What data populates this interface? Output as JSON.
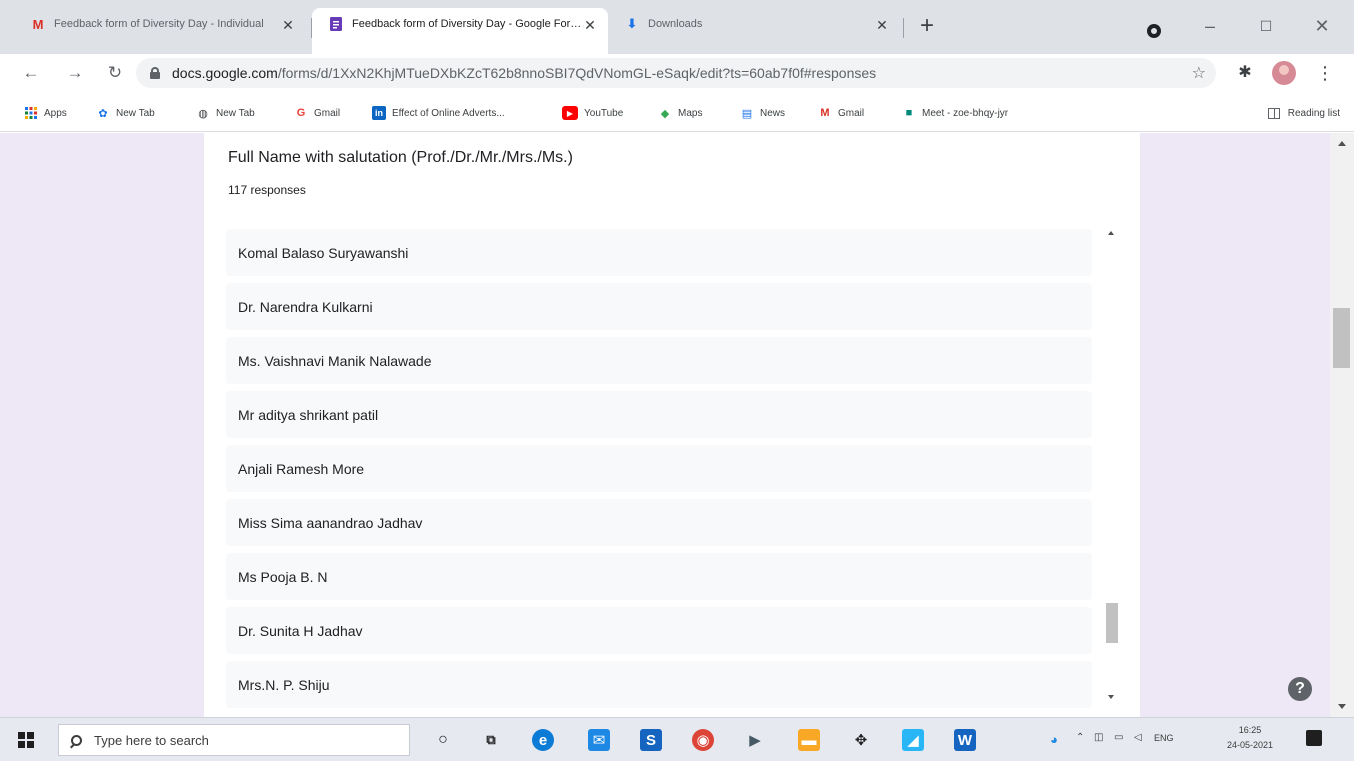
{
  "browser": {
    "tabs": [
      {
        "title": "Feedback form of Diversity Day - Individual",
        "favicon": "gmail-icon",
        "active": false
      },
      {
        "title": "Feedback form of Diversity Day - Google Forms",
        "favicon": "forms-icon",
        "active": true
      },
      {
        "title": "Downloads",
        "favicon": "download-icon",
        "active": false
      }
    ],
    "url_host": "docs.google.com",
    "url_path": "/forms/d/1XxN2KhjMTueDXbKZcT62b8nnoSBI7QdVNomGL-eSaqk/edit?ts=60ab7f0f#responses",
    "bookmarks": [
      "Apps",
      "New Tab",
      "New Tab",
      "Gmail",
      "Effect of Online Adverts...",
      "YouTube",
      "Maps",
      "News",
      "Gmail",
      "Meet - zoe-bhqy-jyr"
    ],
    "reading_list": "Reading list"
  },
  "form": {
    "question_title": "Full Name with salutation (Prof./Dr./Mr./Mrs./Ms.)",
    "response_count": "117 responses",
    "responses": [
      "Komal Balaso Suryawanshi",
      "Dr. Narendra Kulkarni",
      "Ms. Vaishnavi Manik Nalawade",
      "Mr aditya shrikant patil",
      "Anjali Ramesh More",
      "Miss Sima aanandrao Jadhav",
      "Ms Pooja B. N",
      "Dr. Sunita H Jadhav",
      "Mrs.N. P. Shiju"
    ]
  },
  "taskbar": {
    "search_placeholder": "Type here to search",
    "language": "ENG",
    "time": "16:25",
    "date": "24-05-2021"
  },
  "colors": {
    "page_background": "#ede7f6",
    "forms_purple": "#673ab7",
    "card": "#ffffff"
  }
}
